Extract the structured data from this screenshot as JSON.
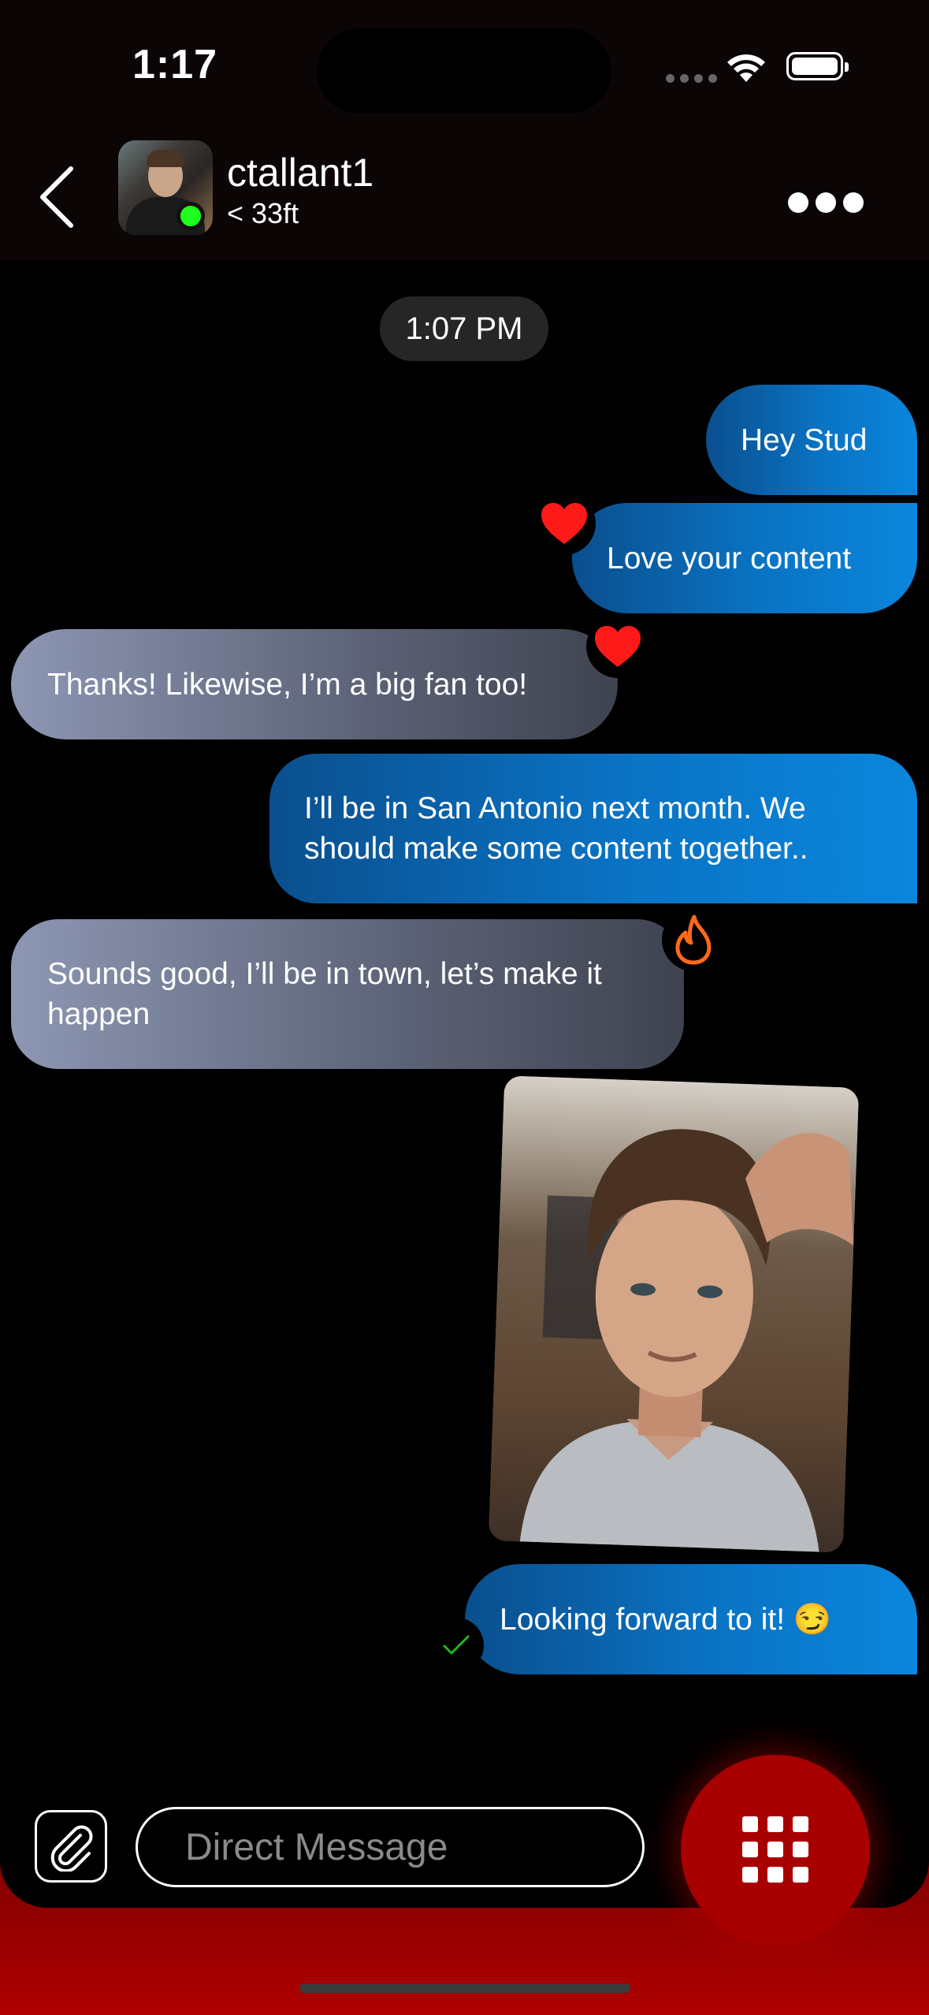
{
  "status_bar": {
    "time": "1:17"
  },
  "header": {
    "username": "ctallant1",
    "distance": "< 33ft",
    "online_color": "#1dff1d"
  },
  "timestamp": "1:07 PM",
  "messages": [
    {
      "direction": "outgoing",
      "text": "Hey Stud"
    },
    {
      "direction": "outgoing",
      "text": "Love your content",
      "reaction": "heart-icon"
    },
    {
      "direction": "incoming",
      "text": "Thanks! Likewise, I’m a big fan too!",
      "reaction": "heart-icon"
    },
    {
      "direction": "outgoing",
      "text": "I’ll be in San Antonio next month.  We should make some content together.."
    },
    {
      "direction": "incoming",
      "text": "Sounds good, I’ll be in town, let’s make it happen",
      "reaction": "flame-icon"
    },
    {
      "direction": "outgoing",
      "type": "photo"
    },
    {
      "direction": "outgoing",
      "text": "Looking forward to it! 😏",
      "status": "check-icon"
    }
  ],
  "composer": {
    "placeholder": "Direct Message"
  },
  "colors": {
    "outgoing_bubble": "#0a73c4",
    "incoming_bubble": "#8d97b3",
    "accent_red": "#a80000",
    "heart": "#ff1a1a",
    "flame": "#ff6a1a",
    "read_check": "#1fb81f"
  }
}
